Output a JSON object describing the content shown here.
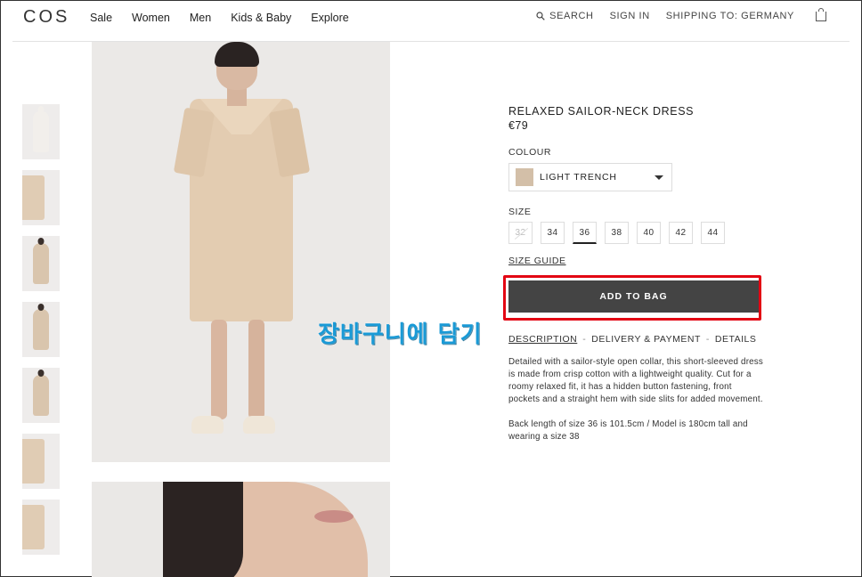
{
  "header": {
    "logo": "COS",
    "nav": [
      "Sale",
      "Women",
      "Men",
      "Kids & Baby",
      "Explore"
    ],
    "search_label": "SEARCH",
    "sign_in": "SIGN IN",
    "shipping_label": "SHIPPING TO:",
    "shipping_country": "GERMANY"
  },
  "product": {
    "title": "RELAXED SAILOR-NECK DRESS",
    "price": "€79",
    "colour_label": "COLOUR",
    "colour_value": "LIGHT TRENCH",
    "colour_swatch": "#d3bfa8",
    "size_label": "SIZE",
    "sizes": [
      {
        "label": "32",
        "available": false
      },
      {
        "label": "34",
        "available": true
      },
      {
        "label": "36",
        "available": true,
        "selected": true
      },
      {
        "label": "38",
        "available": true
      },
      {
        "label": "40",
        "available": true
      },
      {
        "label": "42",
        "available": true
      },
      {
        "label": "44",
        "available": true
      }
    ],
    "size_guide": "SIZE GUIDE",
    "add_to_bag": "ADD TO BAG",
    "tabs": [
      "DESCRIPTION",
      "DELIVERY & PAYMENT",
      "DETAILS"
    ],
    "tab_separator": "-",
    "description": "Detailed with a sailor-style open collar, this short-sleeved dress is made from crisp cotton with a lightweight quality. Cut for a roomy relaxed fit, it has a hidden button fastening, front pockets and a straight hem with side slits for added movement.",
    "fit_note": "Back length of size 36 is 101.5cm / Model is 180cm tall and wearing a size 38"
  },
  "thumbnails_count": 7,
  "annotation": {
    "text": "장바구니에 담기",
    "color": "#1a9ad6",
    "highlight_color": "#e30613"
  }
}
